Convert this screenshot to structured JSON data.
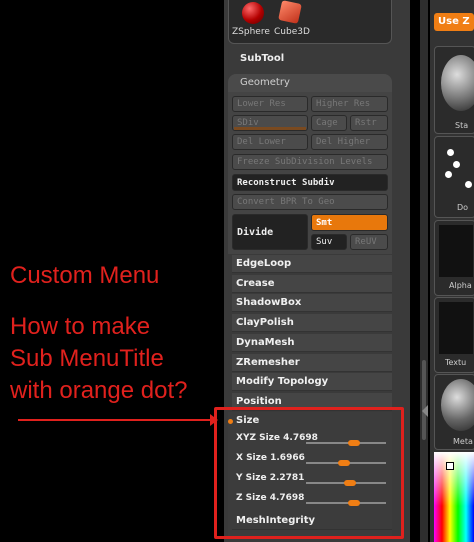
{
  "tool_thumbs": [
    {
      "label": "ZSphere",
      "icon": "zsphere-icon"
    },
    {
      "label": "Cube3D",
      "icon": "cube3d-icon"
    }
  ],
  "subtool_label": "SubTool",
  "geometry": {
    "title": "Geometry",
    "lower_res": "Lower Res",
    "higher_res": "Higher Res",
    "sdiv": "SDiv",
    "cage": "Cage",
    "rstr": "Rstr",
    "del_lower": "Del Lower",
    "del_higher": "Del Higher",
    "freeze": "Freeze SubDivision Levels",
    "reconstruct": "Reconstruct Subdiv",
    "convert": "Convert BPR To Geo",
    "divide": "Divide",
    "smt": "Smt",
    "suv": "Suv",
    "reuv": "ReUV"
  },
  "menu_items": [
    "EdgeLoop",
    "Crease",
    "ShadowBox",
    "ClayPolish",
    "DynaMesh",
    "ZRemesher",
    "Modify Topology",
    "Position"
  ],
  "size_section": {
    "title": "Size",
    "sliders": [
      {
        "label": "XYZ Size",
        "value": "4.7698",
        "fraction": 0.6
      },
      {
        "label": "X Size",
        "value": "1.6966",
        "fraction": 0.48
      },
      {
        "label": "Y Size",
        "value": "2.2781",
        "fraction": 0.55
      },
      {
        "label": "Z Size",
        "value": "4.7698",
        "fraction": 0.6
      }
    ],
    "next_item": "MeshIntegrity"
  },
  "right_strip": {
    "use_button": "Use Z",
    "labels": [
      "Sta",
      "Do",
      "Alpha",
      "Textu",
      "Meta"
    ]
  },
  "annotation": {
    "heading": "Custom Menu",
    "question_lines": [
      "How to make",
      "Sub MenuTitle",
      "with orange dot?"
    ]
  },
  "colors": {
    "accent": "#f07e14",
    "annotation": "#e0211d"
  }
}
